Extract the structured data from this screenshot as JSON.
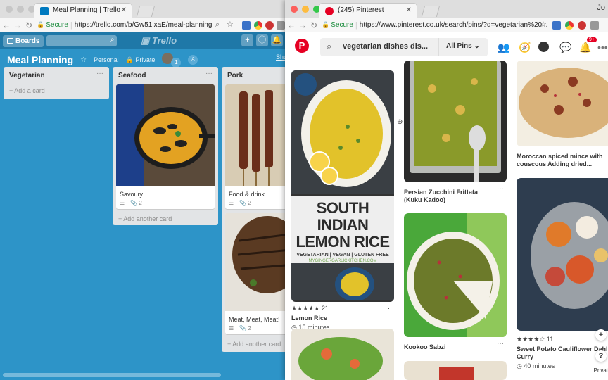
{
  "trello_window": {
    "tab_title": "Meal Planning | Trello",
    "secure_label": "Secure",
    "url": "https://trello.com/b/Gw51lxaE/meal-planning",
    "boards_label": "Boards",
    "logo_text": "Trello",
    "board_title": "Meal Planning",
    "team_label": "Personal",
    "visibility_label": "Private",
    "member_count": "1",
    "show_menu_label": "Sho",
    "lists": [
      {
        "title": "Vegetarian",
        "add_label": "+ Add a card"
      },
      {
        "title": "Seafood",
        "add_label": "+ Add another card",
        "cards": [
          {
            "title": "Savoury",
            "attachments": "2"
          }
        ]
      },
      {
        "title": "Pork",
        "add_label": "+ Add another card",
        "cards": [
          {
            "title": "Food & drink",
            "attachments": "2"
          },
          {
            "title": "Meat, Meat, Meat!",
            "attachments": "2"
          }
        ]
      }
    ]
  },
  "pinterest_window": {
    "tab_title": "(245) Pinterest",
    "secure_label": "Secure",
    "url": "https://www.pinterest.co.uk/search/pins/?q=vegetarian%20...",
    "search_query": "vegetarian dishes dis...",
    "scope_label": "All Pins",
    "notification_count": "9+",
    "pins": [
      {
        "title": "Lemon Rice",
        "rating_count": "21",
        "time": "15 minutes",
        "image_text": {
          "line1": "SOUTH INDIAN",
          "line2": "LEMON RICE",
          "sub": "VEGETARIAN | VEGAN | GLUTEN FREE",
          "site": "MYGINGERGARLICKITCHEN.COM"
        }
      },
      {
        "title": "Persian Zucchini Frittata (Kuku Kadoo)"
      },
      {
        "title": "Kookoo Sabzi"
      },
      {
        "title": "Moroccan spiced mince with couscous Adding dried..."
      },
      {
        "title": "Sweet Potato Cauliflower Dahl Curry",
        "rating_count": "11",
        "time": "40 minutes"
      }
    ],
    "side_tip_label": "Privat",
    "avatar_label": "Jo"
  }
}
